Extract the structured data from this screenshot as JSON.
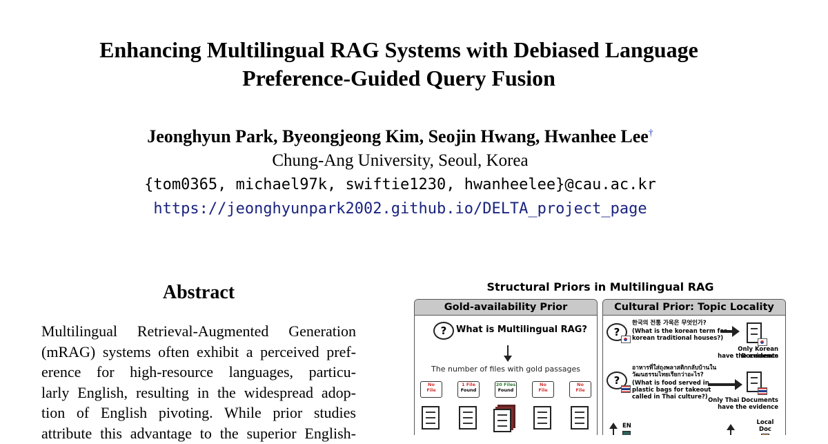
{
  "paper": {
    "title_line1": "Enhancing Multilingual RAG Systems with Debiased Language",
    "title_line2": "Preference-Guided Query Fusion",
    "authors": "Jeonghyun Park, Byeongjeong Kim, Seojin Hwang, Hwanhee Lee",
    "author_mark": "†",
    "affiliation": "Chung-Ang University, Seoul, Korea",
    "emails": "{tom0365, michael97k, swiftie1230, hwanheelee}@cau.ac.kr",
    "url": "https://jeonghyunpark2002.github.io/DELTA_project_page"
  },
  "abstract": {
    "heading": "Abstract",
    "lines": [
      "Multilingual Retrieval-Augmented Generation",
      "(mRAG) systems often exhibit a perceived pref-",
      "erence for high-resource languages, particu-",
      "larly English, resulting in the widespread adop-",
      "tion of English pivoting. While prior studies",
      "attribute this advantage to the superior English-"
    ]
  },
  "figure": {
    "title": "Structural Priors in Multilingual RAG",
    "left_panel": {
      "header": "Gold-availability Prior",
      "question": "What is Multilingual RAG?",
      "caption": "The number of files with gold passages",
      "tags": [
        {
          "line1": "No",
          "line2": "File",
          "color": "red"
        },
        {
          "line1": "1 File",
          "line2": "Found",
          "color": "red"
        },
        {
          "line1": "20 Files",
          "line2": "Found",
          "color": "green"
        },
        {
          "line1": "No",
          "line2": "File",
          "color": "red"
        },
        {
          "line1": "No",
          "line2": "File",
          "color": "red"
        }
      ]
    },
    "right_panel": {
      "header": "Cultural Prior: Topic Locality",
      "q1_native": "한국의 전통 가옥은 무엇인가?",
      "q1_en_line1": "(What is the korean term for",
      "q1_en_line2": "korean traditional houses?)",
      "a1_line1": "Only Korean Documents",
      "a1_line2": "have the evidence",
      "q2_native_line1": "อาหารที่ใส่ถุงพลาสติกกลับบ้านใน",
      "q2_native_line2": "วัฒนธรรมไทยเรียกว่าอะไร?",
      "q2_en_line1": "(What is food served in",
      "q2_en_line2": "plastic bags for takeout",
      "q2_en_line3": "called in Thai culture?)",
      "a2_line1": "Only Thai Documents",
      "a2_line2": "have the evidence",
      "bar_label_left": "EN",
      "bar_label_right_line1": "Local",
      "bar_label_right_line2": "Doc"
    }
  }
}
